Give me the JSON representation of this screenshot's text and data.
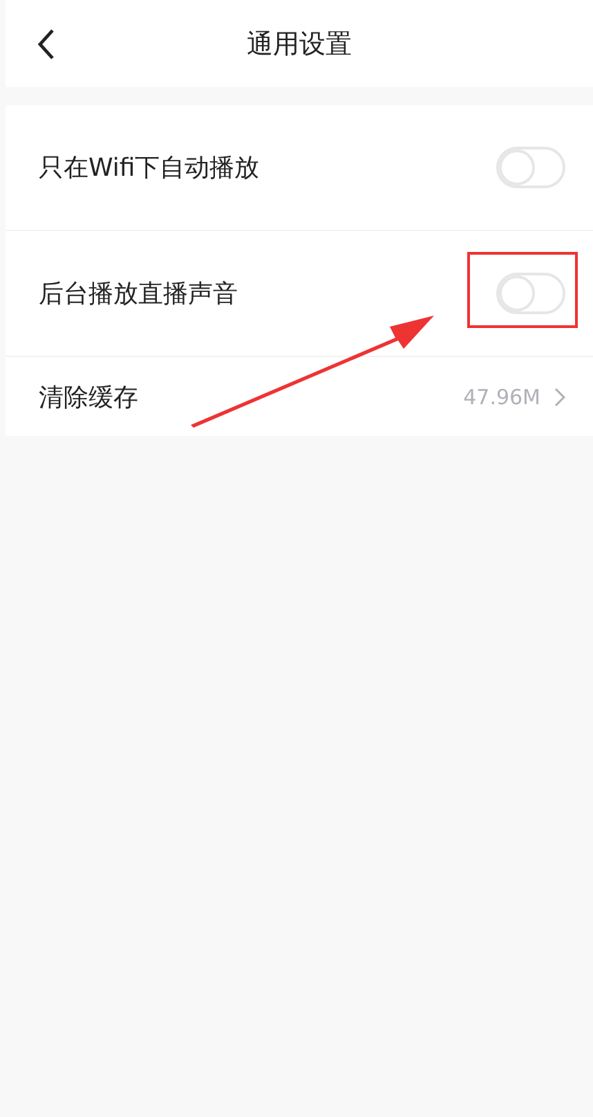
{
  "header": {
    "title": "通用设置"
  },
  "settings": [
    {
      "kind": "toggle",
      "label": "只在Wifi下自动播放",
      "on": false
    },
    {
      "kind": "toggle",
      "label": "后台播放直播声音",
      "on": false
    },
    {
      "kind": "value",
      "label": "清除缓存",
      "value": "47.96M"
    }
  ]
}
